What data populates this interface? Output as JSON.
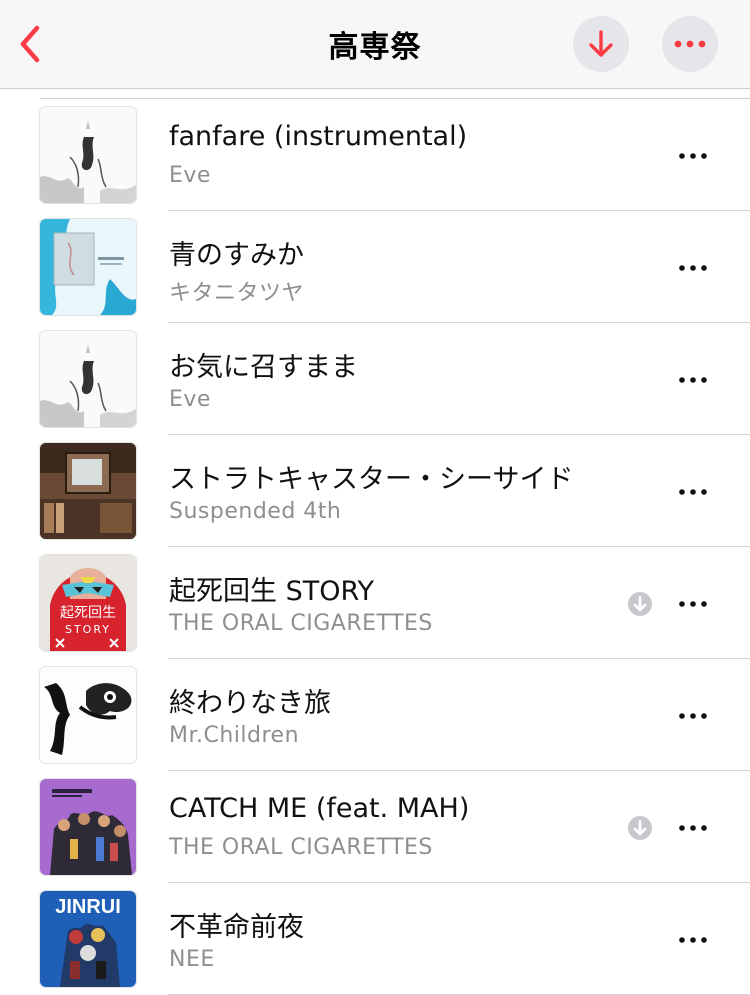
{
  "header": {
    "title": "高専祭",
    "back_icon": "chevron-left-icon",
    "download_icon": "arrow-down-icon",
    "more_icon": "ellipsis-icon",
    "accent_color": "#fc3c44"
  },
  "tracks": [
    {
      "title": "fanfare (instrumental)",
      "artist": "Eve",
      "downloaded": false,
      "art": "sketch-art"
    },
    {
      "title": "青のすみか",
      "artist": "キタニタツヤ",
      "downloaded": false,
      "art": "blue-water-art"
    },
    {
      "title": "お気に召すまま",
      "artist": "Eve",
      "downloaded": false,
      "art": "sketch-art"
    },
    {
      "title": "ストラトキャスター・シーサイド",
      "artist": "Suspended 4th",
      "downloaded": false,
      "art": "tv-shelf-art"
    },
    {
      "title": "起死回生 STORY",
      "artist": "THE ORAL CIGARETTES",
      "downloaded": true,
      "art": "red-mask-art"
    },
    {
      "title": "終わりなき旅",
      "artist": "Mr.Children",
      "downloaded": false,
      "art": "ink-art"
    },
    {
      "title": "CATCH ME (feat. MAH)",
      "artist": "THE ORAL CIGARETTES",
      "downloaded": true,
      "art": "purple-crowd-art"
    },
    {
      "title": "不革命前夜",
      "artist": "NEE",
      "downloaded": false,
      "art": "jinrui-art"
    }
  ],
  "art_text": {
    "jinrui": "JINRUI",
    "story_jp": "起死回生",
    "story_en": "STORY"
  }
}
